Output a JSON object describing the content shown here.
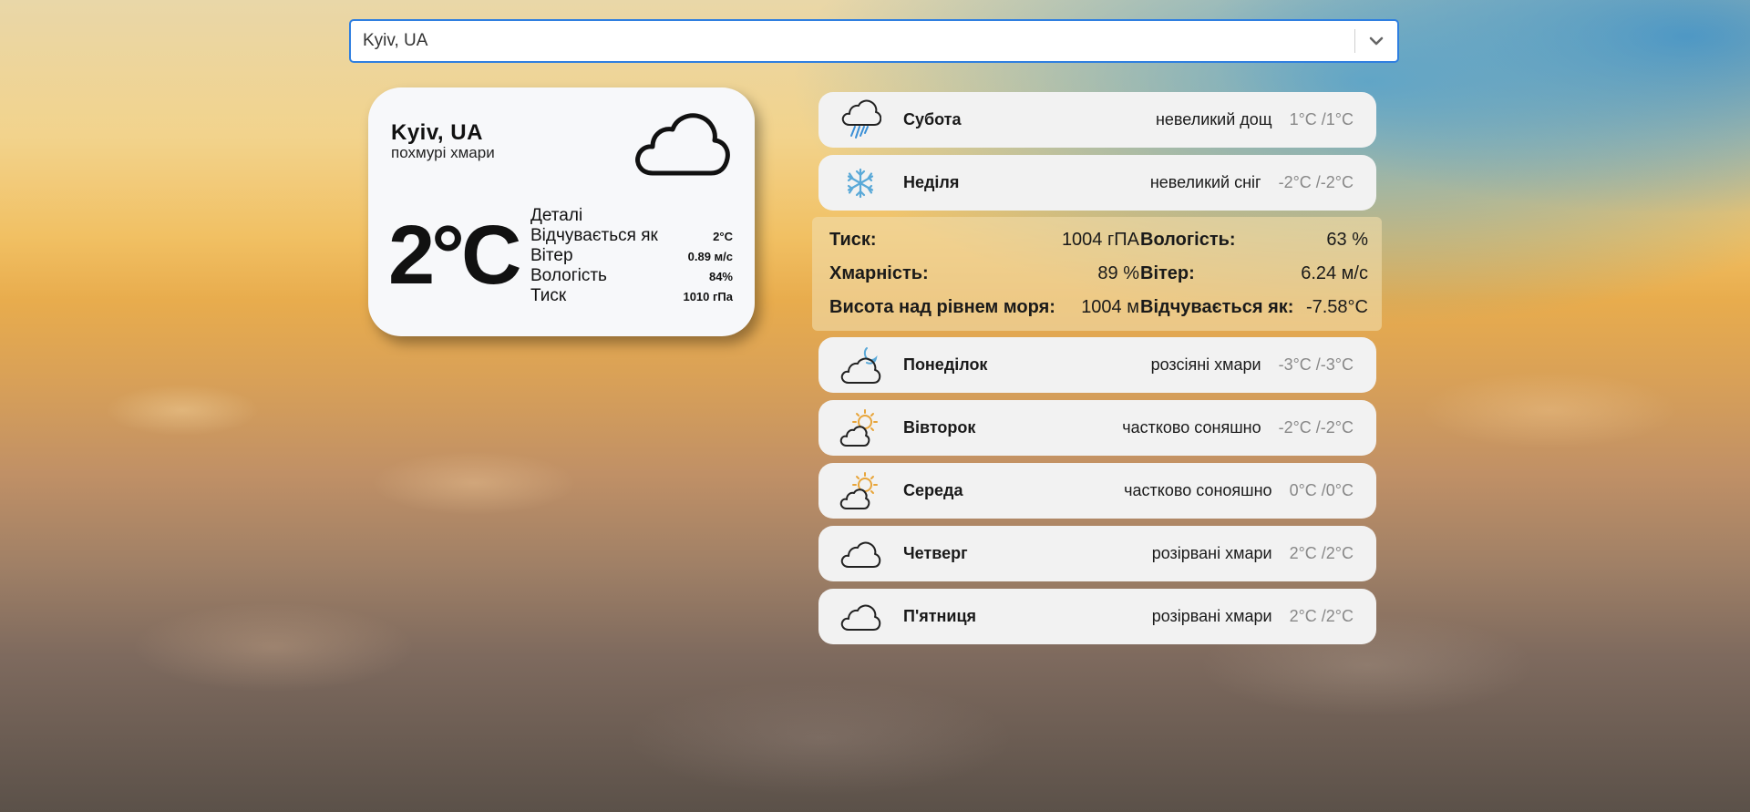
{
  "search": {
    "value": "Kyiv, UA"
  },
  "current": {
    "city": "Kyiv, UA",
    "description": "похмурі хмари",
    "temperature": "2°C",
    "icon": "cloud-icon",
    "details_heading": "Деталі",
    "details": [
      {
        "label": "Відчувається як",
        "value": "2°C"
      },
      {
        "label": "Вітер",
        "value": "0.89 м/с"
      },
      {
        "label": "Вологість",
        "value": "84%"
      },
      {
        "label": "Тиск",
        "value": "1010 гПа"
      }
    ]
  },
  "forecast": [
    {
      "day": "Субота",
      "description": "невеликий дощ",
      "temp": "1°C /1°C",
      "icon": "rain-icon"
    },
    {
      "day": "Неділя",
      "description": "невеликий сніг",
      "temp": "-2°C /-2°C",
      "icon": "snowflake-icon"
    },
    {
      "day": "Понеділок",
      "description": "розсіяні хмари",
      "temp": "-3°C /-3°C",
      "icon": "cloud-moon-icon"
    },
    {
      "day": "Вівторок",
      "description": "частково соняшно",
      "temp": "-2°C /-2°C",
      "icon": "sun-cloud-icon"
    },
    {
      "day": "Середа",
      "description": "частково сонояшно",
      "temp": "0°C /0°C",
      "icon": "sun-cloud-icon"
    },
    {
      "day": "Четверг",
      "description": "розірвані хмари",
      "temp": "2°C /2°C",
      "icon": "cloud-icon"
    },
    {
      "day": "П'ятниця",
      "description": "розірвані хмари",
      "temp": "2°C /2°C",
      "icon": "cloud-icon"
    }
  ],
  "expanded": {
    "pressure_label": "Тиск:",
    "pressure_value": "1004 гПА",
    "humidity_label": "Вологість:",
    "humidity_value": "63 %",
    "clouds_label": "Хмарність:",
    "clouds_value": "89 %",
    "wind_label": "Вітер:",
    "wind_value": "6.24 м/с",
    "sea_level_label": "Висота над рівнем моря:",
    "sea_level_value": "1004 м",
    "feels_label": "Відчувається як:",
    "feels_value": "-7.58°C"
  }
}
